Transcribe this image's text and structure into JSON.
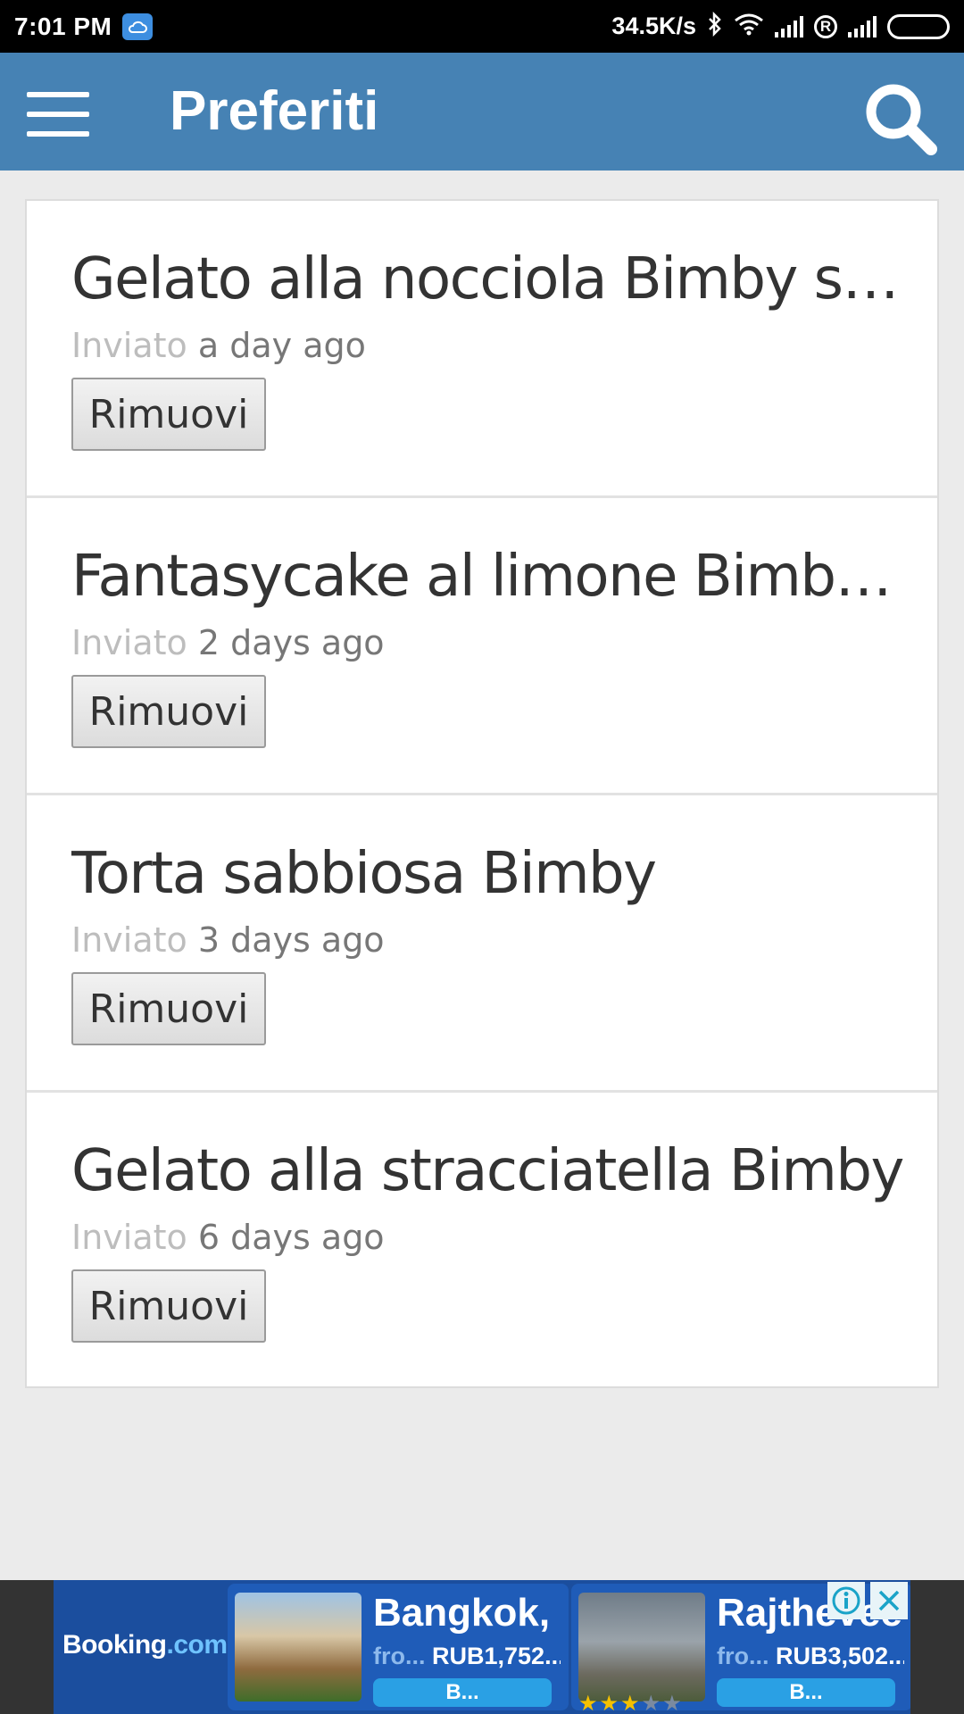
{
  "status_bar": {
    "time": "7:01 PM",
    "speed": "34.5K/s",
    "icons": [
      "cloud-icon",
      "bluetooth-icon",
      "wifi-icon",
      "signal-icon",
      "roaming-icon",
      "signal-icon",
      "battery-icon"
    ],
    "roaming_letter": "R"
  },
  "app_bar": {
    "title": "Preferiti",
    "color": "#4682b4",
    "menu_icon": "hamburger-menu-icon",
    "search_icon": "search-icon"
  },
  "favorites": [
    {
      "title": "Gelato alla nocciola Bimby super...",
      "meta_label": "Inviato",
      "time": "a day ago",
      "button": "Rimuovi"
    },
    {
      "title": "Fantasycake al limone Bimby ide...",
      "meta_label": "Inviato",
      "time": "2 days ago",
      "button": "Rimuovi"
    },
    {
      "title": "Torta sabbiosa Bimby",
      "meta_label": "Inviato",
      "time": "3 days ago",
      "button": "Rimuovi"
    },
    {
      "title": "Gelato alla stracciatella Bimby",
      "meta_label": "Inviato",
      "time": "6 days ago",
      "button": "Rimuovi"
    }
  ],
  "ad": {
    "logo_main": "Booking",
    "logo_dot": ".com",
    "cards": [
      {
        "city": "Bangkok,",
        "from": "fro...",
        "price": "RUB1,752...",
        "button": "B..."
      },
      {
        "city": "Rajthevee",
        "from": "fro...",
        "price": "RUB3,502...",
        "button": "B...",
        "stars": "★★★",
        "stars_off": "★★"
      }
    ]
  }
}
